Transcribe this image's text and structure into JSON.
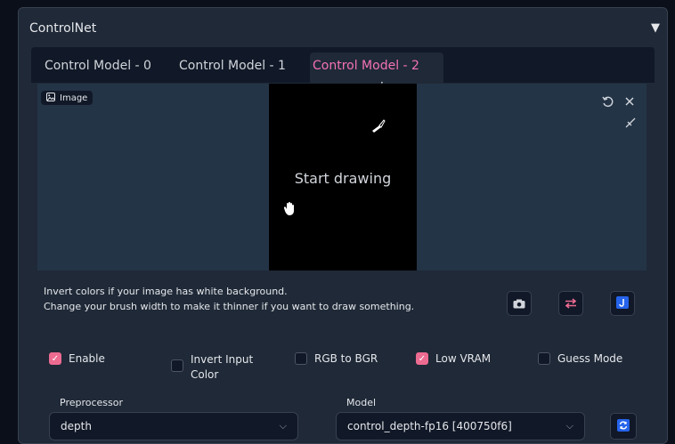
{
  "panel": {
    "title": "ControlNet",
    "collapse_icon": "▼"
  },
  "tabs": [
    {
      "label": "Control Model - 0"
    },
    {
      "label": "Control Model - 1"
    },
    {
      "label": "Control Model - 2",
      "active": true
    }
  ],
  "image": {
    "badge_label": "Image",
    "canvas_text": "Start drawing"
  },
  "info": {
    "line1": "Invert colors if your image has white background.",
    "line2": "Change your brush width to make it thinner if you want to draw something."
  },
  "checkboxes": [
    {
      "label": "Enable",
      "checked": true
    },
    {
      "label": "Invert Input Color",
      "checked": false
    },
    {
      "label": "RGB to BGR",
      "checked": false
    },
    {
      "label": "Low VRAM",
      "checked": true
    },
    {
      "label": "Guess Mode",
      "checked": false
    }
  ],
  "preprocessor": {
    "label": "Preprocessor",
    "value": "depth"
  },
  "model": {
    "label": "Model",
    "value": "control_depth-fp16 [400750f6]"
  },
  "colors": {
    "accent": "#ec6b91",
    "active_tab": "#f472b6",
    "blue_button": "#2563eb"
  }
}
